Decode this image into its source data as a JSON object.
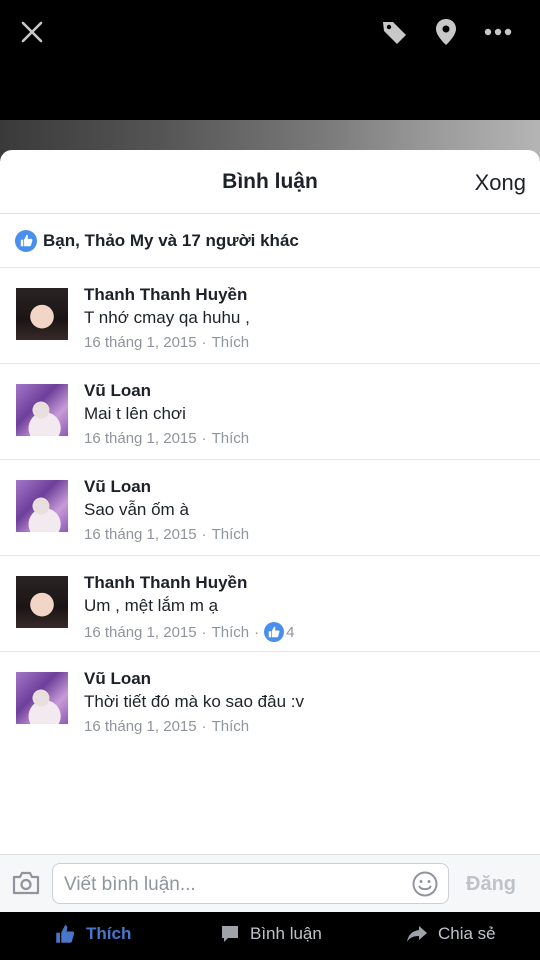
{
  "topbar": {
    "icons": [
      "close-icon",
      "tag-icon",
      "location-pin-icon",
      "more-icon"
    ]
  },
  "sheet": {
    "title": "Bình luận",
    "done_label": "Xong",
    "likes_summary": "Bạn, Thảo My và 17 người khác"
  },
  "comments": [
    {
      "author": "Thanh Thanh Huyền",
      "text": "T nhớ cmay qa huhu ,",
      "date": "16 tháng 1, 2015",
      "like_label": "Thích",
      "likes": ""
    },
    {
      "author": "Vũ Loan",
      "text": "Mai t lên chơi",
      "date": "16 tháng 1, 2015",
      "like_label": "Thích",
      "likes": ""
    },
    {
      "author": "Vũ Loan",
      "text": "Sao vẫn ốm à",
      "date": "16 tháng 1, 2015",
      "like_label": "Thích",
      "likes": ""
    },
    {
      "author": "Thanh Thanh Huyền",
      "text": "Um , mệt lắm m ạ",
      "date": "16 tháng 1, 2015",
      "like_label": "Thích",
      "likes": "4"
    },
    {
      "author": "Vũ Loan",
      "text": "Thời tiết đó mà ko sao đâu :v",
      "date": "16 tháng 1, 2015",
      "like_label": "Thích",
      "likes": ""
    }
  ],
  "composer": {
    "placeholder": "Viết bình luận...",
    "post_label": "Đăng"
  },
  "actions": {
    "like": "Thích",
    "comment": "Bình luận",
    "share": "Chia sẻ"
  },
  "colors": {
    "accent": "#4a8fee",
    "like_active": "#4a76c9"
  }
}
